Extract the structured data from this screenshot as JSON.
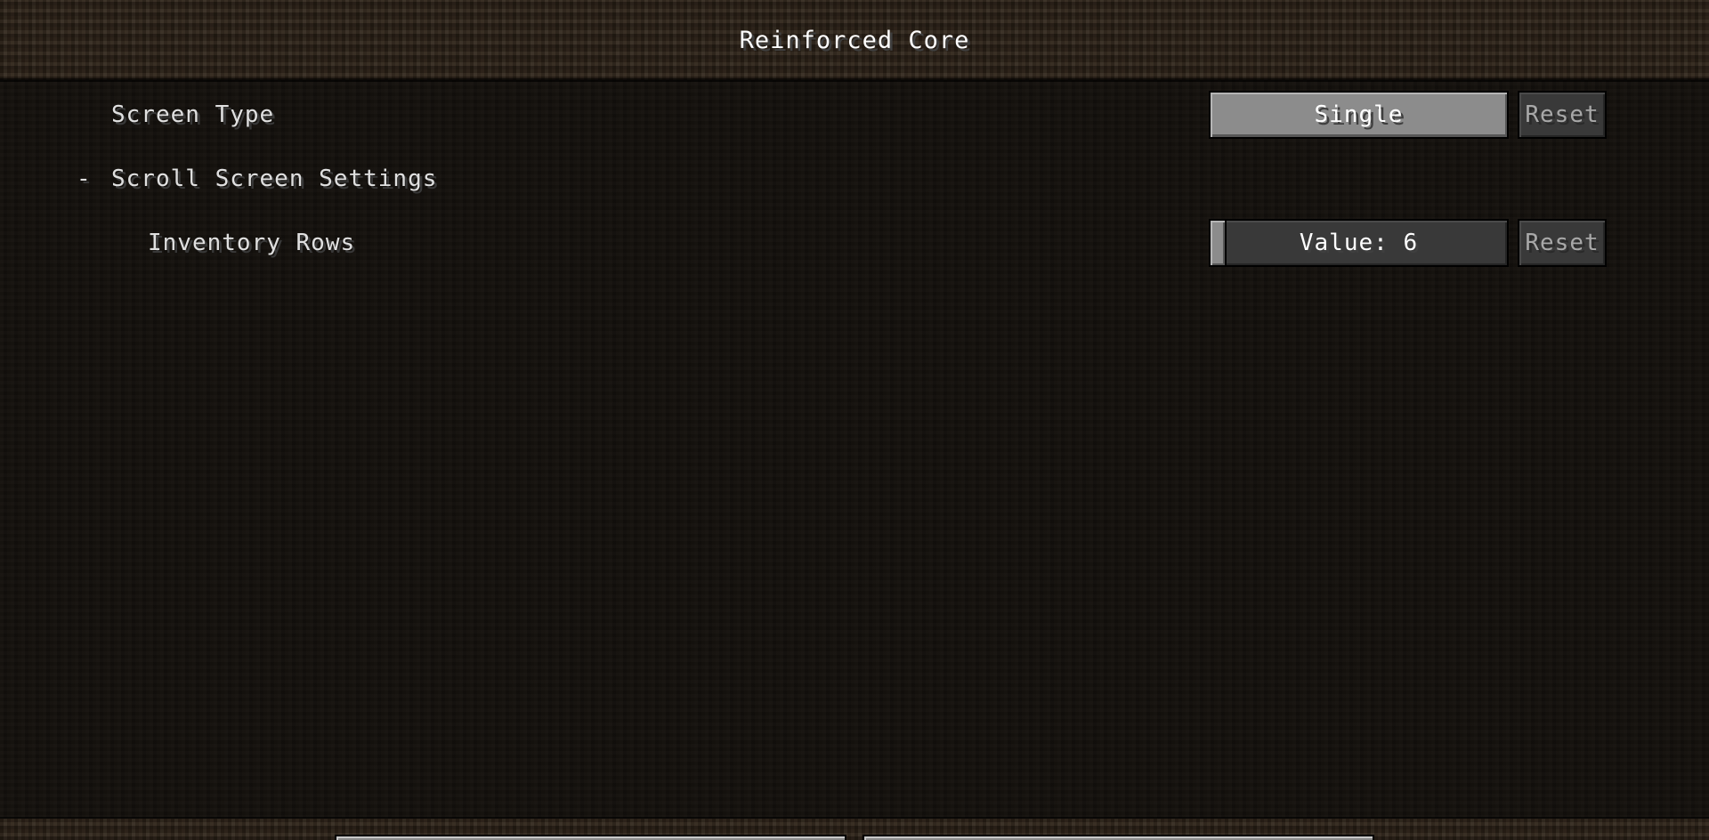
{
  "header": {
    "title": "Reinforced Core"
  },
  "options": {
    "screen_type": {
      "label": "Screen Type",
      "value": "Single",
      "reset_label": "Reset"
    },
    "scroll_section": {
      "toggle_symbol": "-",
      "label": "Scroll Screen Settings"
    },
    "inventory_rows": {
      "label": "Inventory Rows",
      "value_text": "Value: 6",
      "value": 6,
      "reset_label": "Reset"
    }
  },
  "colors": {
    "button_face": "#8c8c8c",
    "button_disabled": "#393939",
    "text_white": "#ffffff",
    "text_label": "#e0e0e0",
    "text_disabled": "#a8a8a8"
  }
}
